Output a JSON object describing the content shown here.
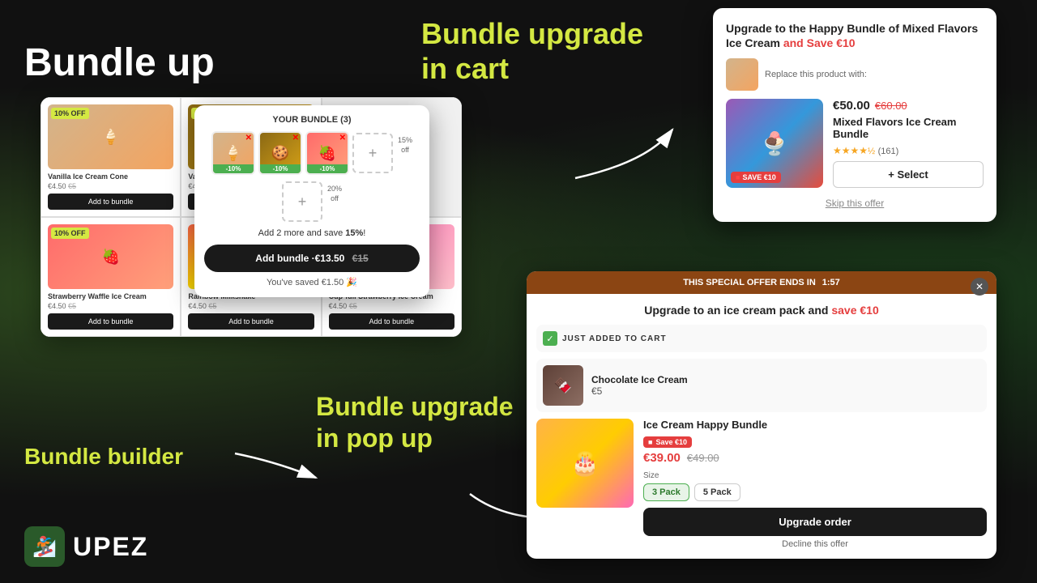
{
  "background": {
    "color": "#111111"
  },
  "main_title": "Bundle up",
  "labels": {
    "bundle_upgrade_cart": "Bundle upgrade\nin cart",
    "bundle_builder": "Bundle builder",
    "bundle_upgrade_popup": "Bundle upgrade\nin pop up"
  },
  "logo": {
    "name": "UPEZ",
    "icon": "🏂"
  },
  "bundle_builder": {
    "panel_title": "YOUR BUNDLE (3)",
    "products": [
      {
        "name": "Vanilla Ice Cream Cone",
        "price": "€4.50",
        "old_price": "€5",
        "badge": "10% OFF",
        "emoji": "🍦"
      },
      {
        "name": "Vanilla Cookie Ice Cream",
        "price": "€4.50",
        "old_price": "€5",
        "badge": "10% OFF",
        "emoji": "🍪"
      },
      {
        "name": "Strawberry Waffle Ice Cream",
        "price": "€4.50",
        "old_price": "€5",
        "badge": "10% OFF",
        "emoji": "🍓"
      },
      {
        "name": "Rainbow Milkshake",
        "price": "€4.50",
        "old_price": "€5",
        "emoji": "🌈"
      },
      {
        "name": "Cup-full Strawberry Ice Cream",
        "price": "€4.50",
        "old_price": "€5",
        "emoji": "🍓"
      }
    ],
    "add_to_bundle": "Add to bundle"
  },
  "bundle_widget": {
    "title": "YOUR BUNDLE (3)",
    "items": [
      {
        "emoji": "🍦",
        "discount": "-10%"
      },
      {
        "emoji": "🍪",
        "discount": "-10%"
      },
      {
        "emoji": "🍓",
        "discount": "-10%"
      }
    ],
    "off_label_1": "15%\noff",
    "off_label_2": "20%\noff",
    "savings_text": "Add 2 more and save 15%!",
    "add_button": "Add bundle ·€13.50",
    "add_button_old_price": "€15",
    "saved_text": "You've saved €1.50 🎉"
  },
  "cart_upgrade": {
    "title_prefix": "Upgrade to the Happy Bundle of Mixed Flavors Ice Cream",
    "title_save": "and Save €10",
    "replace_text": "Replace this product with:",
    "product": {
      "price": "€50.00",
      "old_price": "€60.00",
      "name": "Mixed Flavors Ice Cream Bundle",
      "rating": "★★★★½",
      "review_count": "(161)",
      "save_badge": "SAVE €10",
      "emoji": "🍨"
    },
    "select_button": "+ Select",
    "skip_text": "Skip this offer"
  },
  "popup_upgrade": {
    "header_text": "THIS SPECIAL OFFER ENDS IN",
    "timer": "1:57",
    "upgrade_title_prefix": "Upgrade to an ice cream pack and",
    "upgrade_title_save": "save €10",
    "just_added_label": "JUST ADDED TO CART",
    "added_product": {
      "name": "Chocolate Ice Cream",
      "price": "€5",
      "emoji": "🍫"
    },
    "upgrade_product": {
      "name": "Ice Cream Happy Bundle",
      "save_badge": "Save €10",
      "price": "€39.00",
      "old_price": "€49.00",
      "emoji": "🎂",
      "sizes": [
        "3 Pack",
        "5 Pack"
      ],
      "active_size": "3 Pack"
    },
    "size_label": "Size",
    "upgrade_button": "Upgrade order",
    "decline_text": "Decline this offer"
  }
}
